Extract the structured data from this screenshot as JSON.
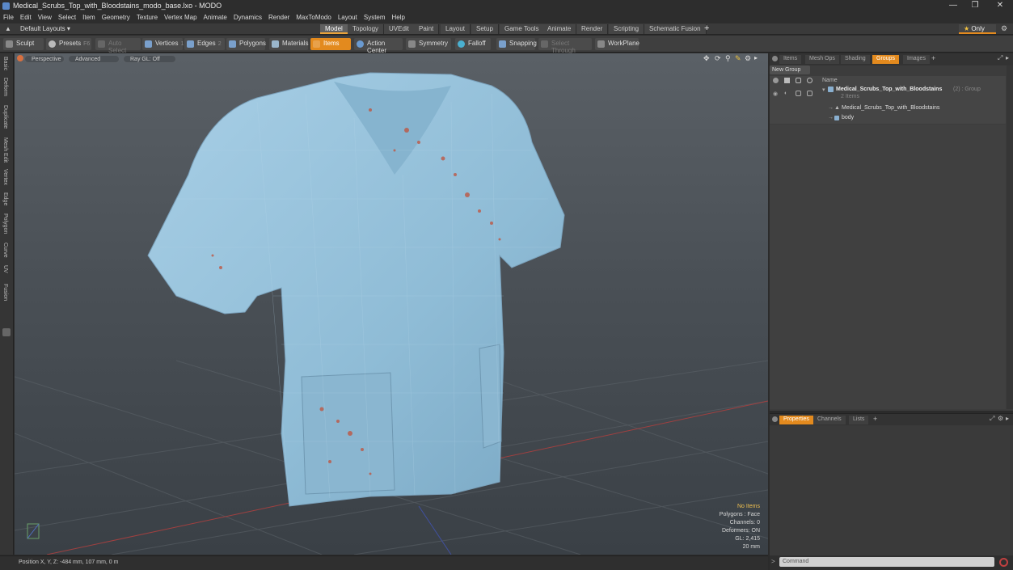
{
  "window": {
    "title": "Medical_Scrubs_Top_with_Bloodstains_modo_base.lxo - MODO"
  },
  "menu": [
    "File",
    "Edit",
    "View",
    "Select",
    "Item",
    "Geometry",
    "Texture",
    "Vertex Map",
    "Animate",
    "Dynamics",
    "Render",
    "MaxToModo",
    "Layout",
    "System",
    "Help"
  ],
  "layouts": {
    "selector": "Default Layouts",
    "tabs": [
      "Model",
      "Topology",
      "UVEdit",
      "Paint",
      "Layout",
      "Setup",
      "Game Tools",
      "Animate",
      "Render",
      "Scripting",
      "Schematic Fusion"
    ],
    "active": "Model",
    "only_label": "Only"
  },
  "toolbar": {
    "sculpt": "Sculpt",
    "presets": "Presets",
    "presets_shortcut": "F6",
    "auto_select": "Auto Select",
    "vertices": "Vertices",
    "vertices_key": "1",
    "edges": "Edges",
    "edges_key": "2",
    "polygons": "Polygons",
    "materials": "Materials",
    "items": "Items",
    "action_center": "Action Center",
    "symmetry": "Symmetry",
    "falloff": "Falloff",
    "snapping": "Snapping",
    "select_through": "Select Through",
    "workplane": "WorkPlane"
  },
  "left_tabs": [
    "Basic",
    "Deform",
    "Duplicate",
    "Mesh Edit",
    "Vertex",
    "Edge",
    "Polygon",
    "Curve",
    "UV",
    "Fusion"
  ],
  "viewport": {
    "perspective": "Perspective",
    "advanced": "Advanced",
    "ray_gl": "Ray GL: Off",
    "stats": {
      "no_items": "No Items",
      "polygons": "Polygons : Face",
      "channels": "Channels: 0",
      "deformers": "Deformers: ON",
      "gl": "GL: 2,415",
      "scale": "20 mm"
    }
  },
  "status": {
    "position": "Position X, Y, Z:  -484 mm, 107 mm, 0 m"
  },
  "right_panel": {
    "tabs": [
      "Items",
      "Mesh Ops",
      "Shading",
      "Groups",
      "Images"
    ],
    "active": "Groups",
    "new_group": "New Group",
    "col_name": "Name",
    "group_name": "Medical_Scrubs_Top_with_Bloodstains",
    "group_count": "(2) : Group",
    "group_items": "2 Items",
    "child1": "Medical_Scrubs_Top_with_Bloodstains",
    "child2": "body"
  },
  "props_panel": {
    "tabs": [
      "Properties",
      "Channels",
      "Lists"
    ],
    "active": "Properties"
  },
  "command": {
    "placeholder": "Command"
  },
  "colors": {
    "accent": "#e38a1e",
    "shirt": "#9cc4dc",
    "blood": "#c0503a"
  }
}
